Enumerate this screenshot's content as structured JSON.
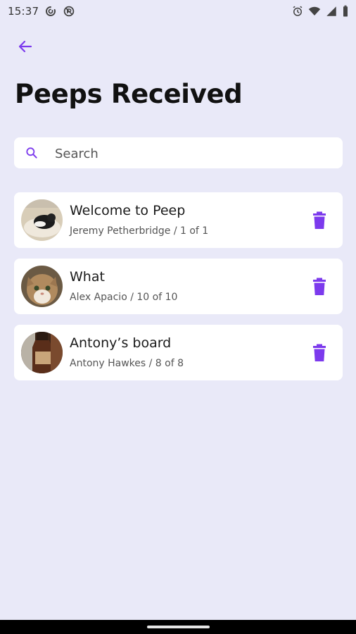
{
  "status_bar": {
    "time": "15:37",
    "left_icons": [
      "sync-icon",
      "blocked-icon"
    ],
    "right_icons": [
      "alarm-icon",
      "wifi-icon",
      "signal-icon",
      "battery-icon"
    ]
  },
  "header": {
    "back_icon": "arrow-left-icon",
    "title": "Peeps Received"
  },
  "search": {
    "placeholder": "Search",
    "value": "",
    "icon": "search-icon"
  },
  "colors": {
    "accent": "#7c3aed",
    "background": "#e9e9f8",
    "card": "#ffffff"
  },
  "peeps": [
    {
      "title": "Welcome to Peep",
      "subtitle": "Jeremy Petherbridge / 1 of 1",
      "avatar": "cat-on-cushion-photo"
    },
    {
      "title": "What",
      "subtitle": "Alex Apacio / 10 of 10",
      "avatar": "tabby-cat-photo"
    },
    {
      "title": "Antony’s board",
      "subtitle": "Antony Hawkes / 8 of 8",
      "avatar": "bottle-photo"
    }
  ]
}
